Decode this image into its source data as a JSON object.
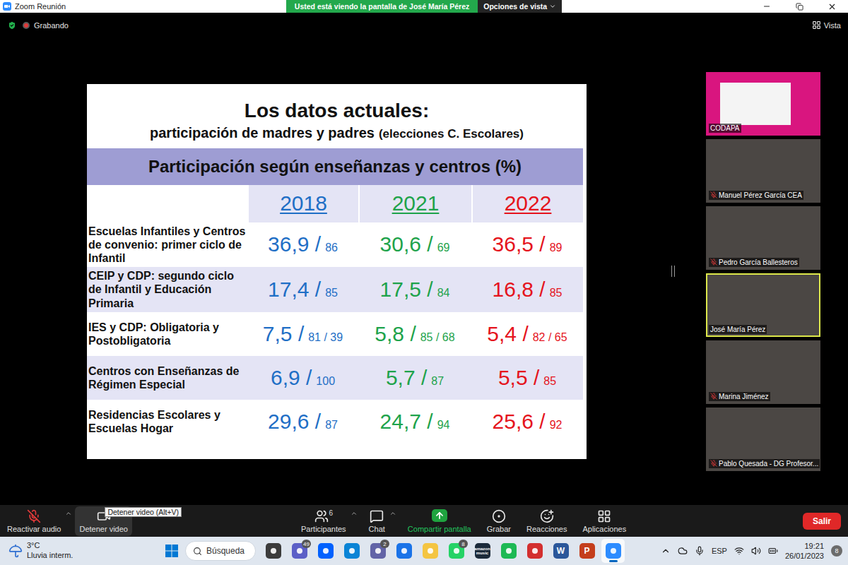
{
  "window": {
    "title": "Zoom Reunión"
  },
  "banner": {
    "text": "Usted está viendo la pantalla de José María Pérez",
    "options": "Opciones de vista"
  },
  "meeting": {
    "recording": "Grabando",
    "view": "Vista"
  },
  "slide": {
    "title": "Los datos actuales:",
    "subtitle": "participación de madres y padres",
    "subtitle_note": "(elecciones C. Escolares)",
    "band": "Participación según enseñanzas y centros (%)",
    "columns": [
      {
        "label": "2018",
        "color": "#1f6fc6"
      },
      {
        "label": "2021",
        "color": "#1ea34b"
      },
      {
        "label": "2022",
        "color": "#e5141d"
      }
    ],
    "rows": [
      {
        "label": "Escuelas Infantiles y Centros de convenio: primer ciclo de Infantil",
        "cells": [
          {
            "value": "36,9 /",
            "base": "86"
          },
          {
            "value": "30,6 /",
            "base": "69"
          },
          {
            "value": "36,5 /",
            "base": "89"
          }
        ]
      },
      {
        "label": "CEIP y CDP: segundo ciclo de Infantil y Educación Primaria",
        "cells": [
          {
            "value": "17,4 /",
            "base": "85"
          },
          {
            "value": "17,5 /",
            "base": "84"
          },
          {
            "value": "16,8 /",
            "base": "85"
          }
        ]
      },
      {
        "label": "IES y CDP: Obligatoria y Postobligatoria",
        "cells": [
          {
            "value": "7,5 /",
            "base": "81 / 39"
          },
          {
            "value": "5,8 /",
            "base": "85 / 68"
          },
          {
            "value": "5,4 /",
            "base": "82 / 65"
          }
        ]
      },
      {
        "label": "Centros con Enseñanzas de Régimen Especial",
        "cells": [
          {
            "value": "6,9 /",
            "base": "100"
          },
          {
            "value": "5,7 /",
            "base": "87"
          },
          {
            "value": "5,5 /",
            "base": "85"
          }
        ]
      },
      {
        "label": "Residencias Escolares y Escuelas Hogar",
        "cells": [
          {
            "value": "29,6 /",
            "base": "87"
          },
          {
            "value": "24,7 /",
            "base": "94"
          },
          {
            "value": "25,6 /",
            "base": "92"
          }
        ]
      }
    ]
  },
  "participants": [
    {
      "name": "CODAPA",
      "kind": "screen",
      "muted": false,
      "selected": false
    },
    {
      "name": "Manuel Pérez García CEA",
      "kind": "camera",
      "muted": true,
      "selected": false
    },
    {
      "name": "Pedro García Ballesteros",
      "kind": "camera",
      "muted": true,
      "selected": false
    },
    {
      "name": "José María Pérez",
      "kind": "camera",
      "muted": false,
      "selected": true
    },
    {
      "name": "Marina Jiménez",
      "kind": "camera",
      "muted": true,
      "selected": false
    },
    {
      "name": "Pablo Quesada - DG Profesor...",
      "kind": "camera",
      "muted": true,
      "selected": false
    }
  ],
  "toolbar": {
    "items": [
      {
        "label": "Reactivar audio",
        "kind": "mic",
        "group": "left",
        "muted": true,
        "caret": true,
        "count": null,
        "hovered": false
      },
      {
        "label": "Detener video",
        "kind": "video",
        "group": "left",
        "muted": false,
        "caret": false,
        "count": null,
        "hovered": true
      },
      {
        "label": "Participantes",
        "kind": "participants",
        "group": "center",
        "muted": false,
        "caret": true,
        "count": "6",
        "hovered": false
      },
      {
        "label": "Chat",
        "kind": "chat",
        "group": "center",
        "muted": false,
        "caret": true,
        "count": null,
        "hovered": false
      },
      {
        "label": "Compartir pantalla",
        "kind": "share",
        "group": "center",
        "muted": false,
        "caret": false,
        "count": null,
        "hovered": false
      },
      {
        "label": "Grabar",
        "kind": "record",
        "group": "center",
        "muted": false,
        "caret": false,
        "count": null,
        "hovered": false
      },
      {
        "label": "Reacciones",
        "kind": "reactions",
        "group": "center",
        "muted": false,
        "caret": false,
        "count": null,
        "hovered": false
      },
      {
        "label": "Aplicaciones",
        "kind": "apps",
        "group": "center",
        "muted": false,
        "caret": false,
        "count": null,
        "hovered": false
      }
    ],
    "tooltip": "Detener video (Alt+V)",
    "leave": "Salir"
  },
  "taskbar": {
    "weather": {
      "temp": "3°C",
      "text": "Lluvia interm."
    },
    "search": "Búsqueda",
    "apps": [
      {
        "kind": "task-view",
        "color": "#3b3b3b",
        "badge": null,
        "glyph": null,
        "selected": false
      },
      {
        "kind": "video-chat",
        "color": "#5b5fc7",
        "badge": "49",
        "glyph": null,
        "selected": false
      },
      {
        "kind": "dropbox",
        "color": "#0061fe",
        "badge": null,
        "glyph": null,
        "selected": false
      },
      {
        "kind": "edge",
        "color": "#0a84d6",
        "badge": null,
        "glyph": null,
        "selected": false
      },
      {
        "kind": "chat",
        "color": "#6264a7",
        "badge": "2",
        "glyph": null,
        "selected": false
      },
      {
        "kind": "calendar",
        "color": "#1a73e8",
        "badge": null,
        "glyph": null,
        "selected": false
      },
      {
        "kind": "explorer",
        "color": "#f4c542",
        "badge": null,
        "glyph": null,
        "selected": false
      },
      {
        "kind": "whatsapp",
        "color": "#25d366",
        "badge": "8",
        "glyph": null,
        "selected": false
      },
      {
        "kind": "amazon-music",
        "color": "#1b2a3a",
        "badge": null,
        "glyph": "amazon music",
        "selected": false
      },
      {
        "kind": "spotify",
        "color": "#1db954",
        "badge": null,
        "glyph": null,
        "selected": false
      },
      {
        "kind": "acrobat",
        "color": "#d32f2f",
        "badge": null,
        "glyph": null,
        "selected": false
      },
      {
        "kind": "word",
        "color": "#2b579a",
        "badge": null,
        "glyph": "W",
        "selected": false
      },
      {
        "kind": "powerpoint",
        "color": "#c43e1c",
        "badge": null,
        "glyph": "P",
        "selected": false
      },
      {
        "kind": "zoom",
        "color": "#2d8cff",
        "badge": null,
        "glyph": null,
        "selected": true
      }
    ],
    "tray": {
      "language": "ESP",
      "time": "19:21",
      "date": "26/01/2023",
      "notifications": "8"
    }
  }
}
